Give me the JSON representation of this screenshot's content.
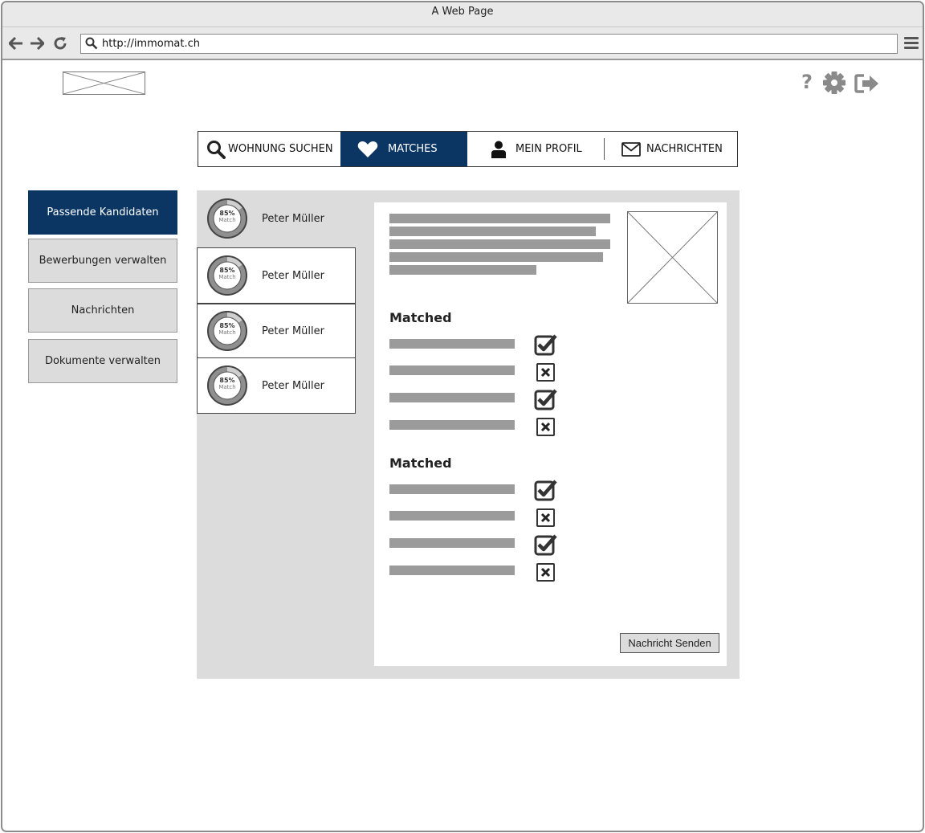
{
  "window": {
    "title": "A Web Page"
  },
  "browser": {
    "url": "http://immomat.ch",
    "icons": [
      "back-arrow-icon",
      "forward-arrow-icon",
      "reload-icon",
      "search-icon",
      "menu-icon"
    ]
  },
  "header": {
    "icons": [
      "help-icon",
      "gear-icon",
      "logout-icon"
    ]
  },
  "main_nav": {
    "tabs": [
      {
        "label": "WOHNUNG SUCHEN",
        "icon": "search-icon",
        "active": false
      },
      {
        "label": "MATCHES",
        "icon": "heart-icon",
        "active": true
      },
      {
        "label": "MEIN PROFIL",
        "icon": "user-icon",
        "active": false
      },
      {
        "label": "NACHRICHTEN",
        "icon": "envelope-icon",
        "active": false
      }
    ]
  },
  "sidebar": {
    "items": [
      {
        "label": "Passende Kandidaten",
        "active": true
      },
      {
        "label": "Bewerbungen verwalten",
        "active": false
      },
      {
        "label": "Nachrichten",
        "active": false
      },
      {
        "label": "Dokumente verwalten",
        "active": false
      }
    ]
  },
  "candidates": [
    {
      "name": "Peter Müller",
      "match_percent": "85%",
      "match_label": "Match",
      "match_value": 0.85,
      "active": true
    },
    {
      "name": "Peter Müller",
      "match_percent": "85%",
      "match_label": "Match",
      "match_value": 0.85,
      "active": false
    },
    {
      "name": "Peter Müller",
      "match_percent": "85%",
      "match_label": "Match",
      "match_value": 0.85,
      "active": false
    },
    {
      "name": "Peter Müller",
      "match_percent": "85%",
      "match_label": "Match",
      "match_value": 0.85,
      "active": false
    }
  ],
  "detail": {
    "sections": [
      {
        "title": "Matched",
        "criteria": [
          true,
          false,
          true,
          false
        ]
      },
      {
        "title": "Matched",
        "criteria": [
          true,
          false,
          true,
          false
        ]
      }
    ],
    "send_button": "Nachricht Senden"
  },
  "colors": {
    "primary": "#0b3664",
    "panel": "#dcdcdc",
    "placeholder_bar": "#9b9b9b",
    "icon_gray": "#8a8a8a"
  }
}
